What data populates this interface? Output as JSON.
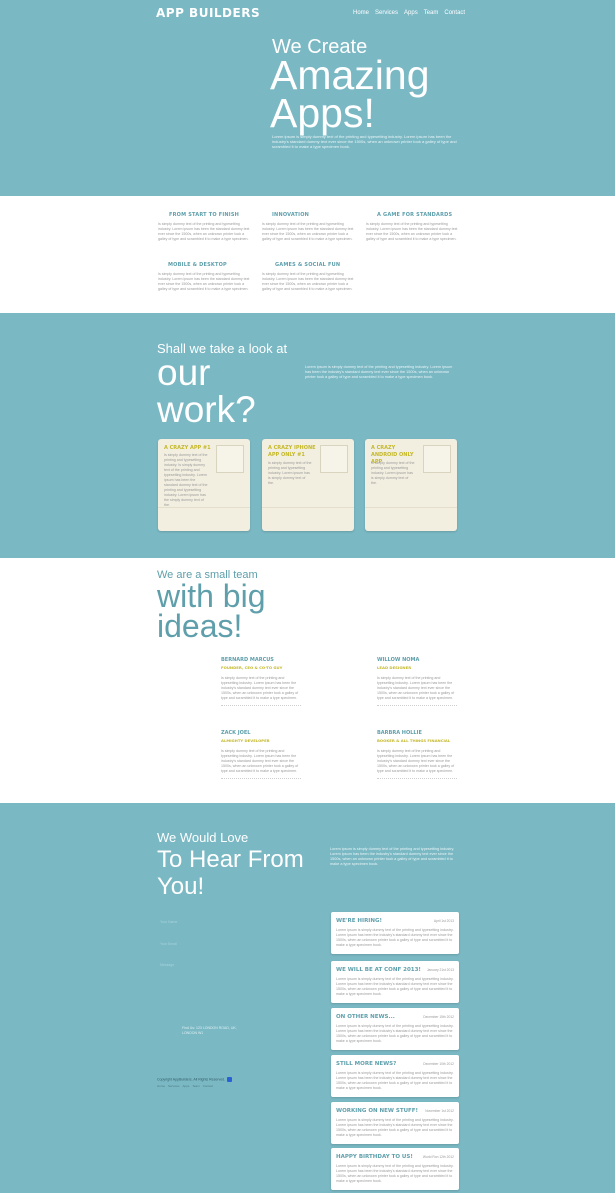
{
  "header": {
    "logo": "APP BUILDERS",
    "nav": [
      "Home",
      "Services",
      "Apps",
      "Team",
      "Contact"
    ]
  },
  "hero": {
    "small": "We Create",
    "big": "Amazing Apps!",
    "text": "Lorem ipsum is simply dummy text of the printing and typesetting industry. Lorem ipsum has been the industry's standard dummy text ever since the 1500s, when an unknown printer took a galley of type and scrambled it to make a type specimen book."
  },
  "features": [
    {
      "title": "FROM START TO FINISH",
      "text": "Is simply dummy text of the printing and typesetting industry. Lorem ipsum has been the standard dummy text ever since the 1500s, when an unknown printer took a galley of type and scrambled it to make a type specimen."
    },
    {
      "title": "INNOVATION",
      "text": "Is simply dummy text of the printing and typesetting industry. Lorem ipsum has been the standard dummy text ever since the 1500s, when an unknown printer took a galley of type and scrambled it to make a type specimen."
    },
    {
      "title": "A GAME FOR STANDARDS",
      "text": "Is simply dummy text of the printing and typesetting industry. Lorem ipsum has been the standard dummy text ever since the 1500s, when an unknown printer took a galley of type and scrambled it to make a type specimen."
    },
    {
      "title": "MOBILE & DESKTOP",
      "text": "Is simply dummy text of the printing and typesetting industry. Lorem ipsum has been the standard dummy text ever since the 1500s, when an unknown printer took a galley of type and scrambled it to make a type specimen."
    },
    {
      "title": "GAMES & SOCIAL FUN",
      "text": "Is simply dummy text of the printing and typesetting industry. Lorem ipsum has been the standard dummy text ever since the 1500s, when an unknown printer took a galley of type and scrambled it to make a type specimen."
    }
  ],
  "work": {
    "small": "Shall we take a look at",
    "big": "our work?",
    "text": "Lorem ipsum is simply dummy text of the printing and typesetting industry. Lorem ipsum has been the industry's standard dummy text ever since the 1500s, when an unknown printer took a galley of type and scrambled it to make a type specimen book.",
    "cards": [
      {
        "title": "A CRAZY APP #1",
        "text": "Is simply dummy text of the printing and typesetting industry. Is simply dummy text of the printing and typesetting industry. Lorem ipsum has been the standard dummy text of the printing and typesetting industry. Lorem ipsum has the simply dummy text of the."
      },
      {
        "title": "A CRAZY IPHONE APP ONLY #1",
        "text": "Is simply dummy text of the printing and typesetting industry. Lorem ipsum has is simply dummy text of the."
      },
      {
        "title": "A CRAZY ANDROID ONLY APP",
        "text": "Is simply dummy text of the printing and typesetting industry. Lorem ipsum has is simply dummy text of the."
      }
    ]
  },
  "team": {
    "small": "We are a small team",
    "big": "with big ideas!",
    "members": [
      {
        "name": "BERNARD MARCUS",
        "role": "FOUNDER, CEO & CO-TO GUY",
        "text": "Is simply dummy text of the printing and typesetting industry. Lorem ipsum has been the industry's standard dummy text ever since the 1500s, when an unknown printer took a galley of type and scrambled it to make a type specimen."
      },
      {
        "name": "WILLOW NOMA",
        "role": "LEAD DESIGNER",
        "text": "Is simply dummy text of the printing and typesetting industry. Lorem ipsum has been the industry's standard dummy text ever since the 1500s, when an unknown printer took a galley of type and scrambled it to make a type specimen."
      },
      {
        "name": "ZACK JOEL",
        "role": "ALMIGHTY DEVELOPER",
        "text": "Is simply dummy text of the printing and typesetting industry. Lorem ipsum has been the industry's standard dummy text ever since the 1500s, when an unknown printer took a galley of type and scrambled it to make a type specimen."
      },
      {
        "name": "BARBRA HOLLIE",
        "role": "BOOKER & ALL THINGS FINANCIAL",
        "text": "Is simply dummy text of the printing and typesetting industry. Lorem ipsum has been the industry's standard dummy text ever since the 1500s, when an unknown printer took a galley of type and scrambled it to make a type specimen."
      }
    ]
  },
  "contact": {
    "small": "We Would Love",
    "big": "To Hear From You!",
    "text": "Lorem ipsum is simply dummy text of the printing and typesetting industry. Lorem ipsum has been the industry's standard dummy text ever since the 1500s, when an unknown printer took a galley of type and scrambled it to make a type specimen book.",
    "fields": [
      "Your Name",
      "Your Email",
      "Message"
    ],
    "address": "Find Us: 123 LONDON ROAD, UK, LONDON W1",
    "copyright": "Copyright AppBuilders. All Rights Reserved.",
    "footer_nav": [
      "Home",
      "Services",
      "Apps",
      "Team",
      "Contact"
    ]
  },
  "news": [
    {
      "title": "WE'RE HIRING!",
      "date": "April 1st 2013",
      "text": "Lorem ipsum is simply dummy text of the printing and typesetting industry. Lorem ipsum has been the industry's standard dummy text ever since the 1500s, when an unknown printer took a galley of type and scrambled it to make a type specimen book."
    },
    {
      "title": "WE WILL BE AT CONF 2013!",
      "date": "January 21st 2013",
      "text": "Lorem ipsum is simply dummy text of the printing and typesetting industry. Lorem ipsum has been the industry's standard dummy text ever since the 1500s, when an unknown printer took a galley of type and scrambled it to make a type specimen book."
    },
    {
      "title": "ON OTHER NEWS...",
      "date": "December 15th 2012",
      "text": "Lorem ipsum is simply dummy text of the printing and typesetting industry. Lorem ipsum has been the industry's standard dummy text ever since the 1500s, when an unknown printer took a galley of type and scrambled it to make a type specimen book."
    },
    {
      "title": "STILL MORE NEWS?",
      "date": "December 10th 2012",
      "text": "Lorem ipsum is simply dummy text of the printing and typesetting industry. Lorem ipsum has been the industry's standard dummy text ever since the 1500s, when an unknown printer took a galley of type and scrambled it to make a type specimen book."
    },
    {
      "title": "WORKING ON NEW STUFF!",
      "date": "November 1st 2012",
      "text": "Lorem ipsum is simply dummy text of the printing and typesetting industry. Lorem ipsum has been the industry's standard dummy text ever since the 1500s, when an unknown printer took a galley of type and scrambled it to make a type specimen book."
    },
    {
      "title": "HAPPY BIRTHDAY TO US!",
      "date": "World Ron 12th 2012",
      "text": "Lorem ipsum is simply dummy text of the printing and typesetting industry. Lorem ipsum has been the industry's standard dummy text ever since the 1500s, when an unknown printer took a galley of type and scrambled it to make a type specimen book."
    }
  ]
}
